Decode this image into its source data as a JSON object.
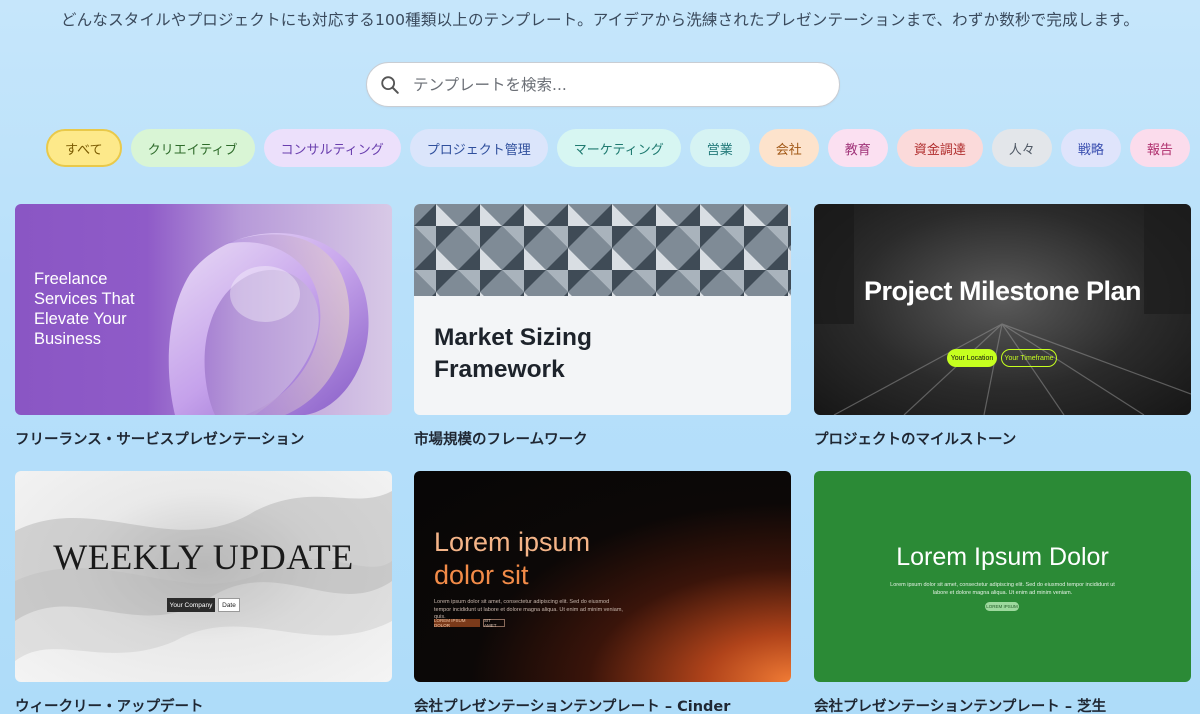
{
  "subtitle": "どんなスタイルやプロジェクトにも対応する100種類以上のテンプレート。アイデアから洗練されたプレゼンテーションまで、わずか数秒で完成します。",
  "search": {
    "placeholder": "テンプレートを検索..."
  },
  "categories": [
    {
      "label": "すべて",
      "bg": "#fde98a",
      "fg": "#7a5a00",
      "border": "#e9c94a",
      "selected": true
    },
    {
      "label": "クリエイティブ",
      "bg": "#d9f5d5",
      "fg": "#2e6b2a"
    },
    {
      "label": "コンサルティング",
      "bg": "#ece0fb",
      "fg": "#6a3fae"
    },
    {
      "label": "プロジェクト管理",
      "bg": "#dbe5fb",
      "fg": "#2f4f9c"
    },
    {
      "label": "マーケティング",
      "bg": "#d7f6f2",
      "fg": "#1f7a70"
    },
    {
      "label": "営業",
      "bg": "#d6f3f3",
      "fg": "#227979"
    },
    {
      "label": "会社",
      "bg": "#fde3cc",
      "fg": "#a15816"
    },
    {
      "label": "教育",
      "bg": "#fbe0f1",
      "fg": "#a1357a"
    },
    {
      "label": "資金調達",
      "bg": "#fbdada",
      "fg": "#b02c2c"
    },
    {
      "label": "人々",
      "bg": "#e3e6ea",
      "fg": "#515a66"
    },
    {
      "label": "戦略",
      "bg": "#dfe4fb",
      "fg": "#3a4fb0"
    },
    {
      "label": "報告",
      "bg": "#fbdcec",
      "fg": "#b0306e"
    }
  ],
  "templates": [
    {
      "label": "フリーランス・サービスプレゼンテーション",
      "heading": "Freelance Services That Elevate Your Business"
    },
    {
      "label": "市場規模のフレームワーク",
      "heading": "Market Sizing Framework"
    },
    {
      "label": "プロジェクトのマイルストーン",
      "heading": "Project Milestone Plan",
      "pill1": "Your Location",
      "pill2": "Your Timeframe"
    },
    {
      "label": "ウィークリー・アップデート",
      "heading": "WEEKLY UPDATE",
      "tag1": "Your Company",
      "tag2": "Date"
    },
    {
      "label": "会社プレゼンテーションテンプレート – Cinder",
      "heading_1": "Lorem ipsum",
      "heading_2": "dolor sit",
      "body": "Lorem ipsum dolor sit amet, consectetur adipiscing elit. Sed do eiusmod tempor incididunt ut labore et dolore magna aliqua. Ut enim ad minim veniam, quis.",
      "tag1": "LOREM IPSUM DOLOR",
      "tag2": "SIT AMET"
    },
    {
      "label": "会社プレゼンテーションテンプレート – 芝生",
      "heading": "Lorem Ipsum Dolor",
      "body": "Lorem ipsum dolor sit amet, consectetur adipiscing elit. Sed do eiusmod tempor incididunt ut labore et dolore magna aliqua. Ut enim ad minim veniam.",
      "tag1": "LOREM IPSUM"
    }
  ]
}
